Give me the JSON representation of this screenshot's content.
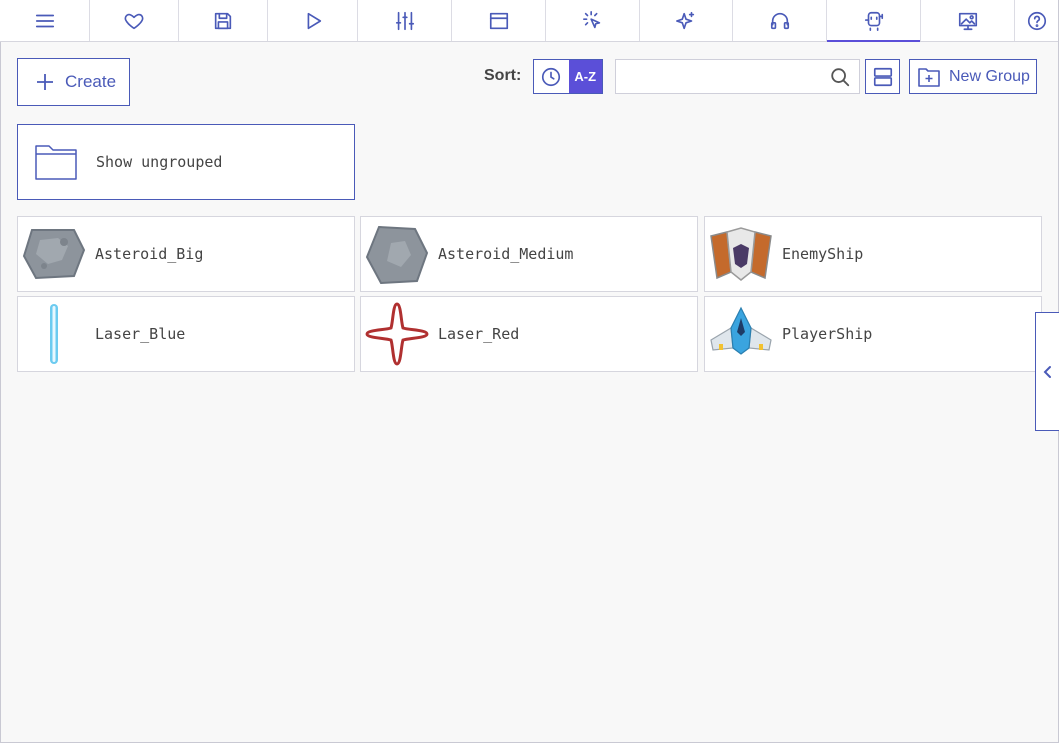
{
  "toolbar": {
    "tabs": [
      {
        "icon": "menu-icon"
      },
      {
        "icon": "heart-icon"
      },
      {
        "icon": "save-icon"
      },
      {
        "icon": "play-icon"
      },
      {
        "icon": "sliders-icon"
      },
      {
        "icon": "room-icon"
      },
      {
        "icon": "cursor-click-icon"
      },
      {
        "icon": "sparkles-icon"
      },
      {
        "icon": "headphones-icon"
      },
      {
        "icon": "robot-icon",
        "active": true
      },
      {
        "icon": "image-monitor-icon"
      },
      {
        "icon": "help-icon"
      }
    ]
  },
  "create_label": "Create",
  "sort": {
    "label": "Sort:",
    "az_label": "A-Z",
    "selected": "A-Z"
  },
  "search": {
    "value": "",
    "placeholder": ""
  },
  "new_group_label": "New Group",
  "ungrouped_label": "Show ungrouped",
  "assets": [
    {
      "name": "Asteroid_Big",
      "icon": "asteroid-big-sprite"
    },
    {
      "name": "Asteroid_Medium",
      "icon": "asteroid-medium-sprite"
    },
    {
      "name": "EnemyShip",
      "icon": "enemy-ship-sprite"
    },
    {
      "name": "Laser_Blue",
      "icon": "laser-blue-sprite"
    },
    {
      "name": "Laser_Red",
      "icon": "laser-red-sprite"
    },
    {
      "name": "PlayerShip",
      "icon": "player-ship-sprite"
    }
  ],
  "colors": {
    "accent": "#4a5ab8",
    "active": "#5b4fd8"
  }
}
